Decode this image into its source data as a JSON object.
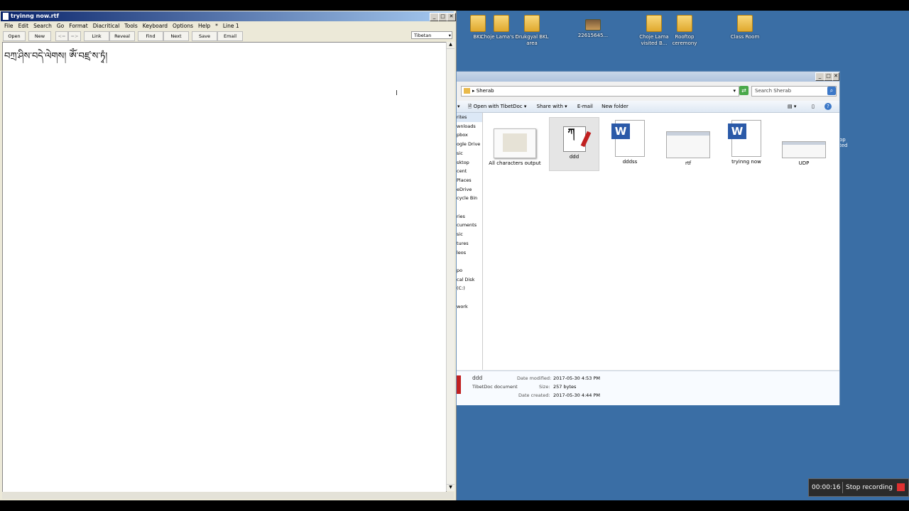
{
  "desktop": {
    "icons": [
      {
        "label": "BKL"
      },
      {
        "label": "Choje Lama's t..."
      },
      {
        "label": "Drukgyal BKL area"
      },
      {
        "label": "22615645..."
      },
      {
        "label": "Choje Lama visited B..."
      },
      {
        "label": "Rooftop ceremony"
      },
      {
        "label": "Class Room"
      }
    ],
    "partial_text": [
      "op",
      "ted"
    ]
  },
  "editor": {
    "title": "tryinng now.rtf",
    "menu": [
      "File",
      "Edit",
      "Search",
      "Go",
      "Format",
      "Diacritical",
      "Tools",
      "Keyboard",
      "Options",
      "Help",
      "*",
      "Line 1"
    ],
    "toolbar": [
      "Open",
      "New",
      "<=",
      "=>",
      "Link",
      "Reveal",
      "Find",
      "Next",
      "Save",
      "Email"
    ],
    "font_select": "Tibetan",
    "document_text": "བཀྲ་ཤིས་བདེ་ལེགས། ཨོཾ་བཛྲ་ས་ཏྭཾ།"
  },
  "explorer": {
    "address": "Sherab",
    "search_placeholder": "Search Sherab",
    "commands": [
      "Open with TibetDoc",
      "Share with",
      "E-mail",
      "New folder"
    ],
    "nav": [
      "rites",
      "wnloads",
      "pbox",
      "ogle Drive",
      "sic",
      "sktop",
      "cent Places",
      "eDrive",
      "cycle Bin",
      "",
      "ries",
      "cuments",
      "sic",
      "tures",
      "leos",
      "",
      "po",
      "cal Disk (C:)",
      "",
      "work"
    ],
    "files": [
      {
        "name": "All characters output"
      },
      {
        "name": "ddd"
      },
      {
        "name": "dddss"
      },
      {
        "name": "rtf"
      },
      {
        "name": "tryinng now"
      },
      {
        "name": "UDP"
      }
    ],
    "details": {
      "name": "ddd",
      "type": "TibetDoc document",
      "modified_label": "Date modified:",
      "modified": "2017-05-30 4:53 PM",
      "size_label": "Size:",
      "size": "257 bytes",
      "created_label": "Date created:",
      "created": "2017-05-30 4:44 PM"
    }
  },
  "recording": {
    "time": "00:00:16",
    "label": "Stop recording"
  }
}
